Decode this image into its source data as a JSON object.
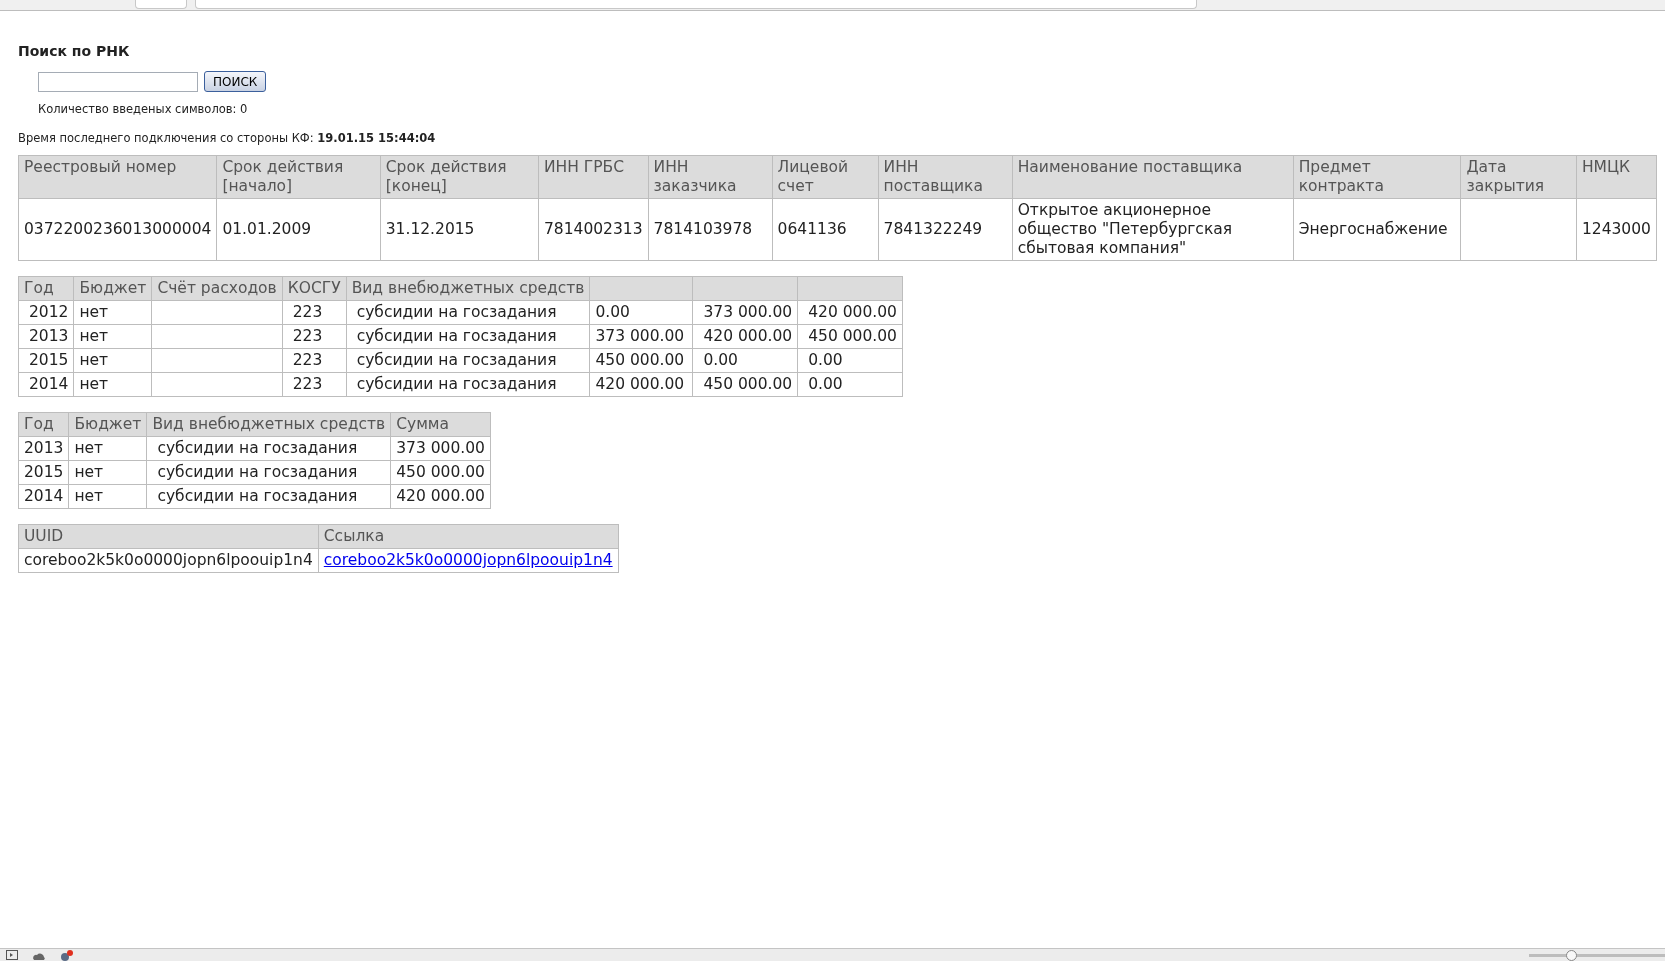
{
  "search": {
    "title": "Поиск по РНК",
    "button": "ПОИСК",
    "counter": "Количество введеных символов: 0"
  },
  "connection": {
    "label": "Время последнего подключения со стороны КФ:",
    "value": "19.01.15 15:44:04"
  },
  "contracts": {
    "columns": [
      "Реестровый номер",
      "Срок действия [начало]",
      "Срок действия [конец]",
      "ИНН ГРБС",
      "ИНН заказчика",
      "Лицевой счет",
      "ИНН поставщика",
      "Наименование поставщика",
      "Предмет контракта",
      "Дата закрытия",
      "НМЦК"
    ],
    "rows": [
      [
        "0372200236013000004",
        "01.01.2009",
        "31.12.2015",
        "7814002313",
        "7814103978",
        "0641136",
        "7841322249",
        "Открытое акционерное общество \"Петербургская сбытовая компания\"",
        "Энергоснабжение",
        "",
        "1243000"
      ]
    ]
  },
  "funding": {
    "columns": [
      "Год",
      "Бюджет",
      "Счёт расходов",
      "КОСГУ",
      "Вид внебюджетных средств",
      null,
      null,
      null
    ],
    "rows": [
      [
        "2012",
        "нет",
        "",
        "223",
        "субсидии на госзадания",
        "0.00",
        "373 000.00",
        "420 000.00"
      ],
      [
        "2013",
        "нет",
        "",
        "223",
        "субсидии на госзадания",
        "373 000.00",
        "420 000.00",
        "450 000.00"
      ],
      [
        "2015",
        "нет",
        "",
        "223",
        "субсидии на госзадания",
        "450 000.00",
        "0.00",
        "0.00"
      ],
      [
        "2014",
        "нет",
        "",
        "223",
        "субсидии на госзадания",
        "420 000.00",
        "450 000.00",
        "0.00"
      ]
    ]
  },
  "totals": {
    "columns": [
      "Год",
      "Бюджет",
      "Вид внебюджетных средств",
      "Сумма"
    ],
    "rows": [
      [
        "2013",
        "нет",
        "субсидии на госзадания",
        "373 000.00"
      ],
      [
        "2015",
        "нет",
        "субсидии на госзадания",
        "450 000.00"
      ],
      [
        "2014",
        "нет",
        "субсидии на госзадания",
        "420 000.00"
      ]
    ]
  },
  "links": {
    "columns": [
      "UUID",
      "Ссылка"
    ],
    "rows": [
      {
        "uuid": "coreboo2k5k0o0000jopn6lpoouip1n4",
        "link": "coreboo2k5k0o0000jopn6lpoouip1n4"
      }
    ]
  },
  "status_bar": {
    "zoom": {
      "level": 0.3
    }
  }
}
